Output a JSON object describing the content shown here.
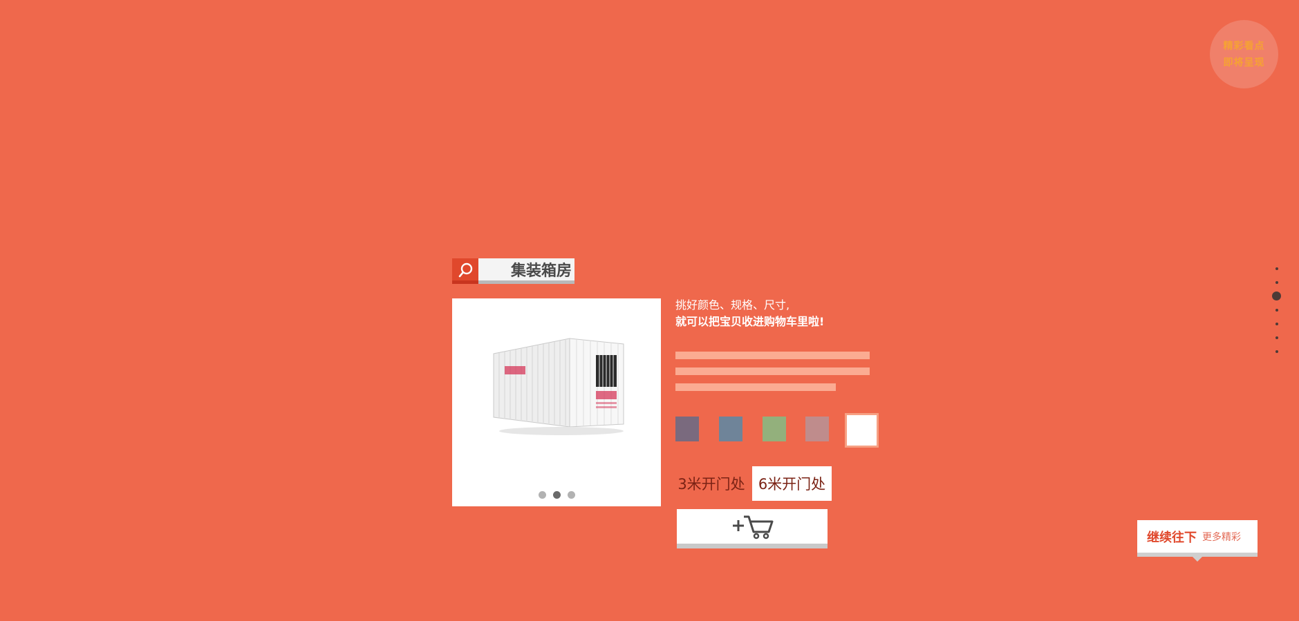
{
  "corner_badge": {
    "line1": "精彩看点",
    "line2": "即将呈现"
  },
  "search": {
    "icon": "search-icon",
    "label": "集装箱房"
  },
  "product": {
    "image_alt": "container-house-image",
    "carousel": {
      "count": 3,
      "active_index": 1
    }
  },
  "hint": {
    "line1": "挑好颜色、规格、尺寸,",
    "line2": "就可以把宝贝收进购物车里啦!"
  },
  "colors": {
    "background": "#ef684c",
    "swatches": [
      "#7a6a7e",
      "#6f8499",
      "#93b07c",
      "#bf8c8c",
      "#ffffff"
    ],
    "selected_swatch_index": 4
  },
  "sizes": [
    {
      "label": "3米开门处",
      "selected": false
    },
    {
      "label": "6米开门处",
      "selected": true
    }
  ],
  "cart": {
    "icon": "add-to-cart-icon"
  },
  "side_nav": {
    "count": 7,
    "active_index": 2
  },
  "continue": {
    "main": "继续往下",
    "sub": "更多精彩"
  }
}
